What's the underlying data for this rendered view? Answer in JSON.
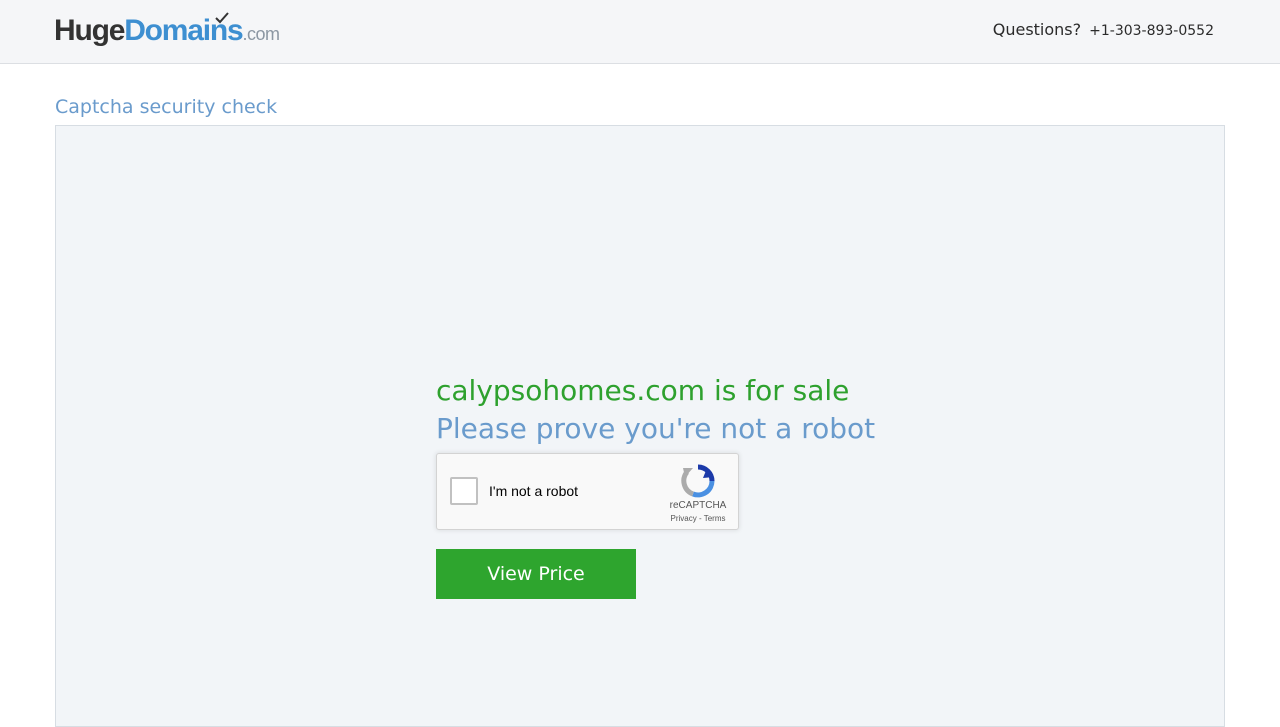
{
  "header": {
    "logo": {
      "huge": "Huge",
      "domains": "Domains",
      "dotcom": ".com"
    },
    "questions_label": "Questions?",
    "phone": "+1-303-893-0552"
  },
  "main": {
    "section_title": "Captcha security check",
    "sale_title": "calypsohomes.com is for sale",
    "prove_title": "Please prove you're not a robot",
    "recaptcha": {
      "label": "I'm not a robot",
      "brand": "reCAPTCHA",
      "privacy": "Privacy",
      "separator": " - ",
      "terms": "Terms"
    },
    "view_price_button": "View Price"
  },
  "colors": {
    "sale_green": "#2ea12e",
    "button_green": "#2ea52e",
    "accent_blue": "#6a9bcc",
    "logo_blue": "#3d8fd1"
  },
  "icons": {
    "logo_check": "checkmark-icon",
    "recaptcha_logo": "recaptcha-logo-icon"
  }
}
